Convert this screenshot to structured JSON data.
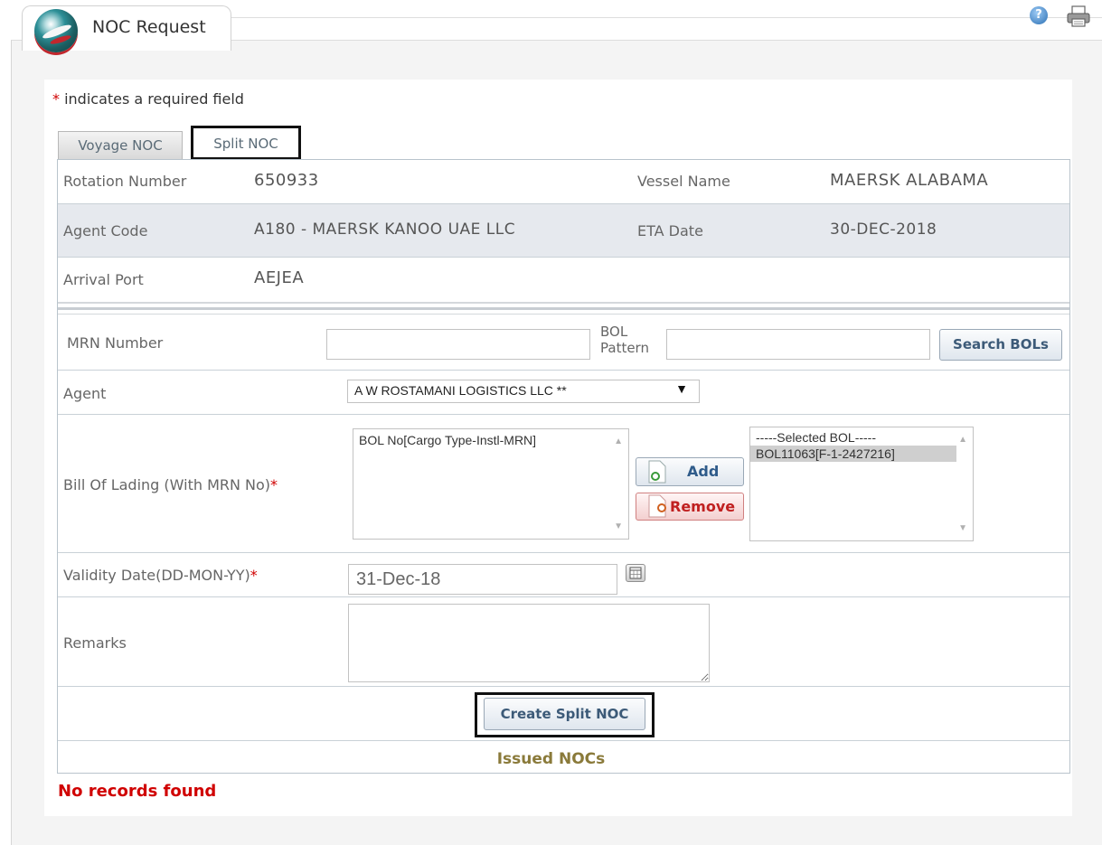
{
  "header": {
    "title": "NOC Request",
    "help_icon": "help-icon",
    "print_icon": "print-icon"
  },
  "required_note": {
    "star": "*",
    "text": " indicates a required field"
  },
  "tabs": [
    {
      "label": "Voyage NOC",
      "active": false
    },
    {
      "label": "Split NOC",
      "active": true
    }
  ],
  "voyage": {
    "rotation_number_label": "Rotation Number",
    "rotation_number": "650933",
    "vessel_name_label": "Vessel Name",
    "vessel_name": "MAERSK ALABAMA",
    "agent_code_label": "Agent Code",
    "agent_code": "A180 - MAERSK KANOO UAE LLC",
    "eta_date_label": "ETA Date",
    "eta_date": "30-DEC-2018",
    "arrival_port_label": "Arrival Port",
    "arrival_port": "AEJEA"
  },
  "form": {
    "mrn_label": "MRN Number",
    "mrn_value": "",
    "bol_pattern_label_1": "BOL",
    "bol_pattern_label_2": "Pattern",
    "bol_pattern_value": "",
    "search_button": "Search BOLs",
    "agent_label": "Agent",
    "agent_selected": "A W ROSTAMANI LOGISTICS LLC **",
    "bill_label": "Bill Of Lading (With MRN No)",
    "required_star": "*",
    "available_bols_header": "BOL No[Cargo Type-Instl-MRN]",
    "add_button": "Add",
    "remove_button": "Remove",
    "selected_bols_header": "-----Selected BOL-----",
    "selected_bols": [
      "BOL11063[F-1-2427216]"
    ],
    "validity_label": "Validity Date(DD-MON-YY)",
    "validity_value": "31-Dec-18",
    "remarks_label": "Remarks",
    "remarks_value": "",
    "create_button": "Create Split NOC"
  },
  "issued": {
    "heading": "Issued NOCs",
    "empty_message": "No records found"
  },
  "colors": {
    "required": "#d00000",
    "issued_heading": "#8a7a3a",
    "row_gray": "#e6e9ee"
  }
}
